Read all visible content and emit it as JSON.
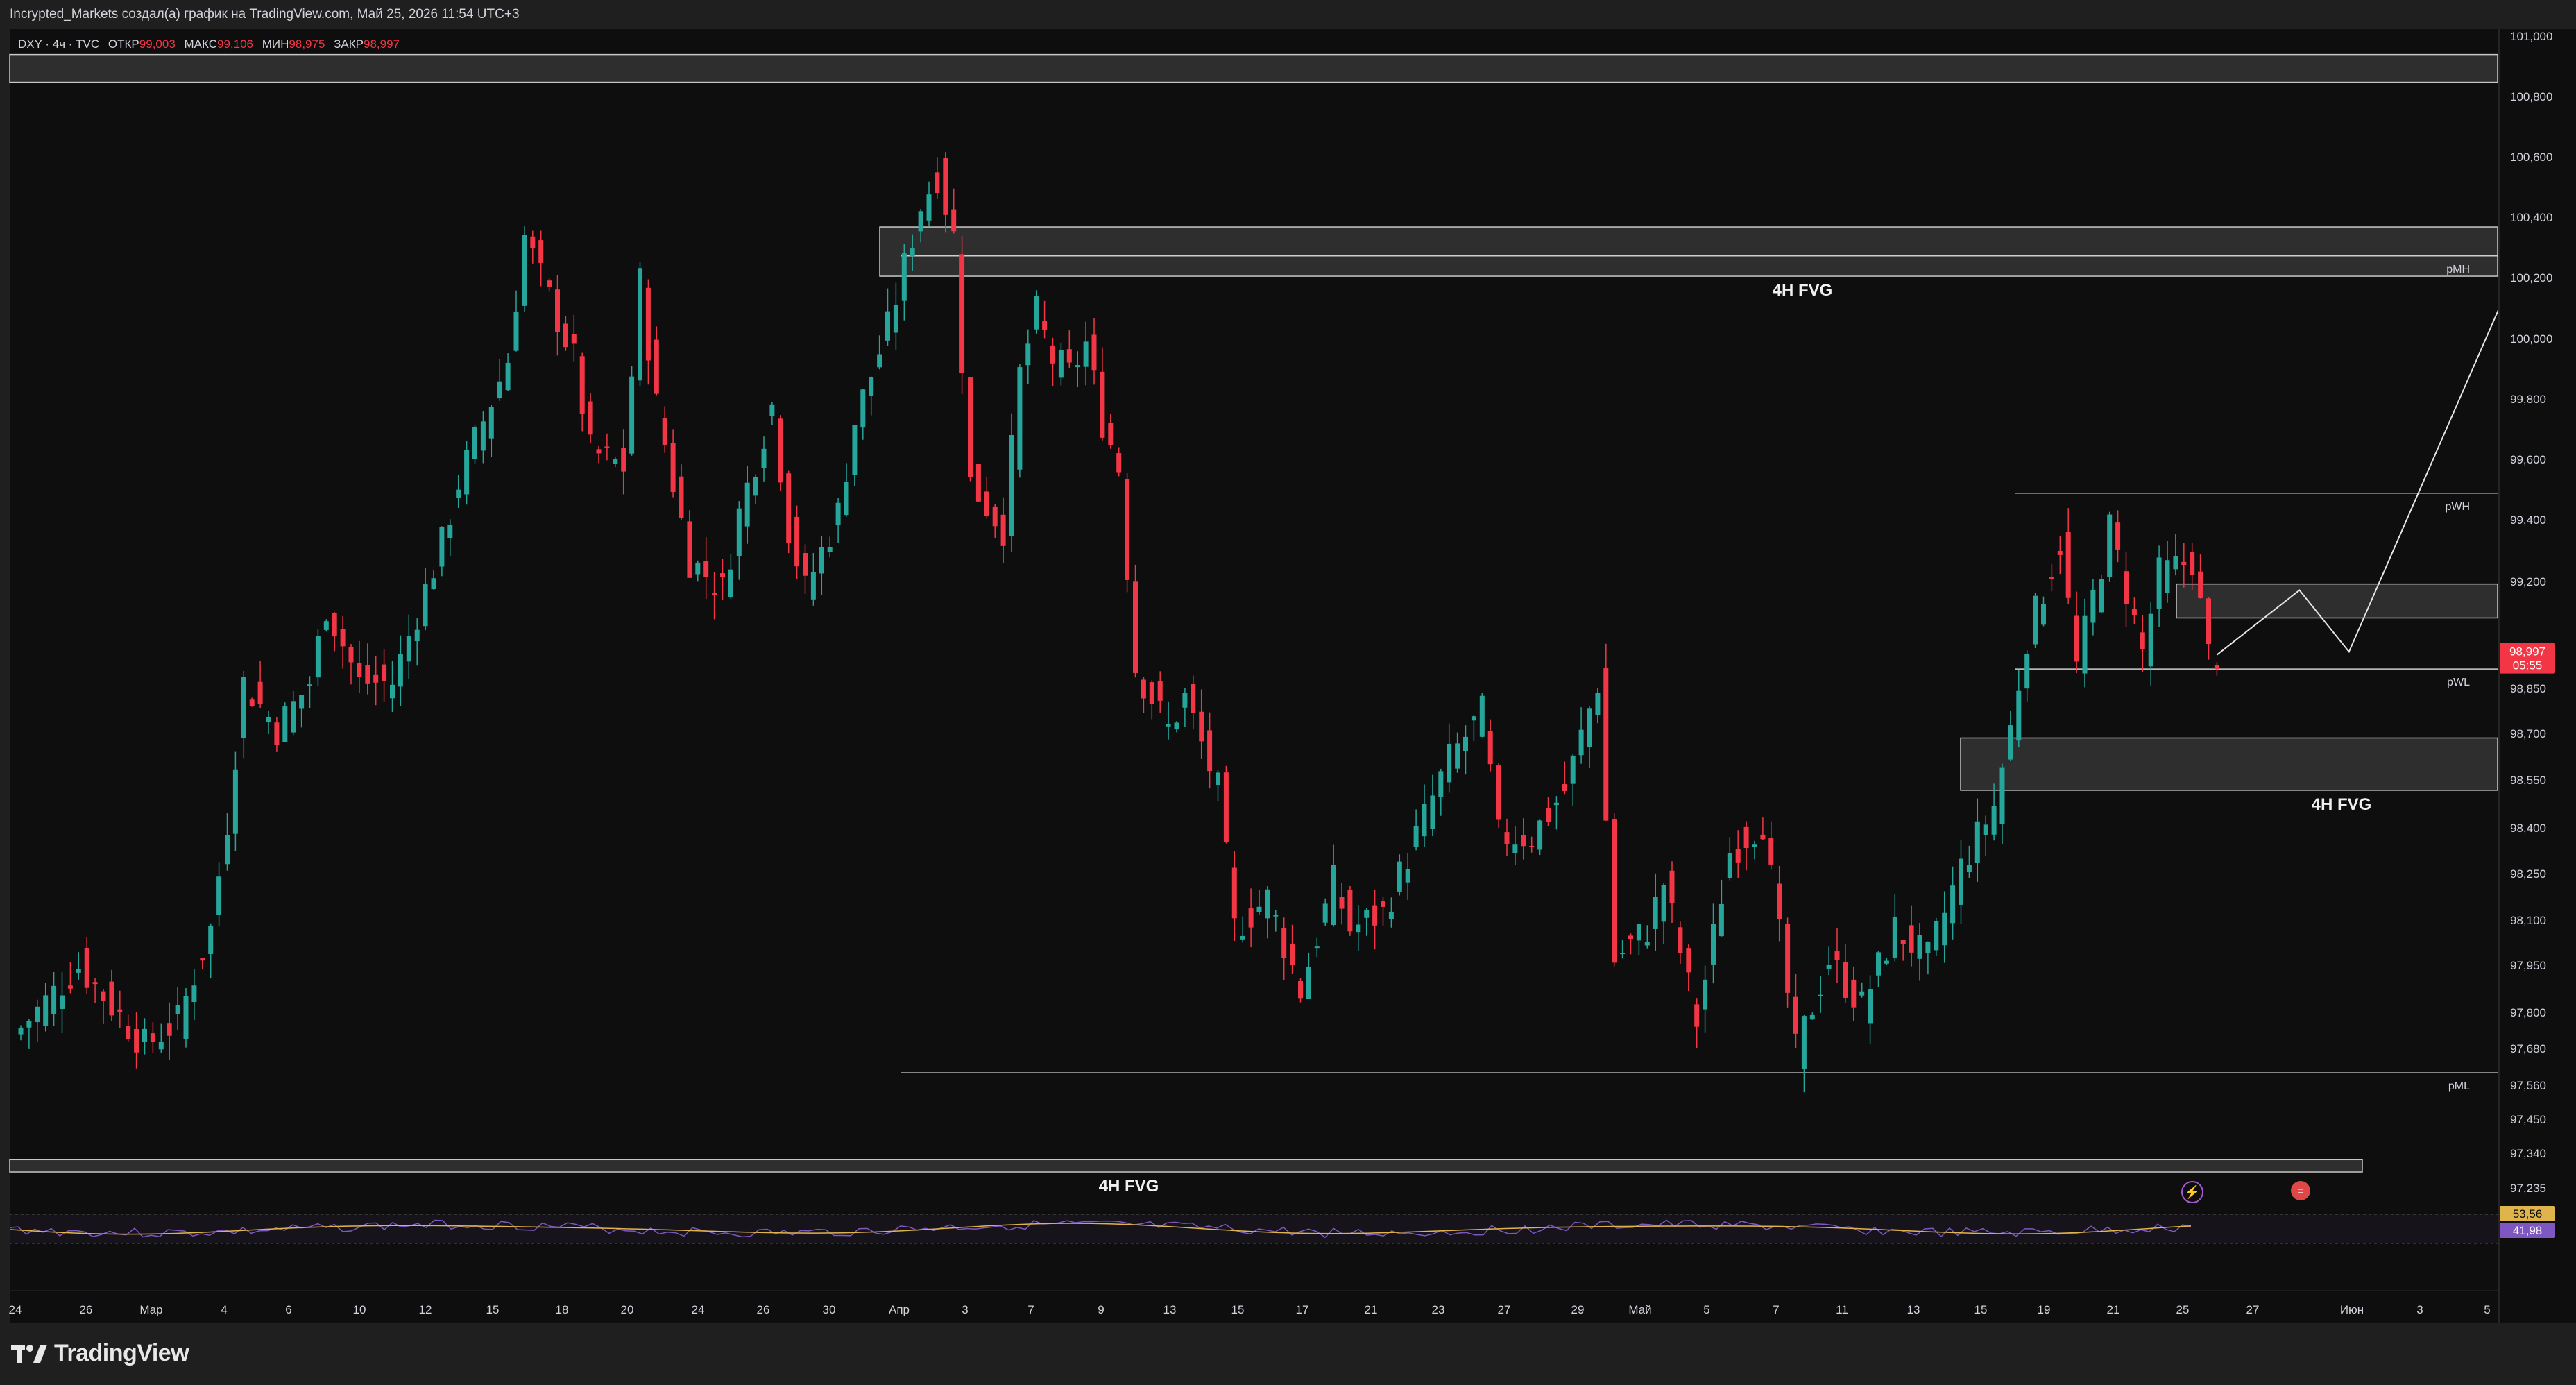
{
  "header": {
    "attribution": "Incrypted_Markets создал(а) график на TradingView.com, Май 25, 2026 11:54 UTC+3"
  },
  "legend": {
    "symbol": "DXY · 4ч · TVC",
    "open_label": "ОТКР",
    "open_value": "99,003",
    "high_label": "МАКС",
    "high_value": "99,106",
    "low_label": "МИН",
    "low_value": "98,975",
    "close_label": "ЗАКР",
    "close_value": "98,997"
  },
  "footer": {
    "brand": "TradingView"
  },
  "icons": {
    "lightning": "lightning-icon",
    "flag": "flag-event-icon"
  },
  "colors": {
    "up": "#26a69a",
    "down": "#f23645",
    "background": "#0e0e0e",
    "zone_fill": "#3a3a3a",
    "zone_border": "#c8c8c8",
    "rsi": "#7e57c2",
    "rsi_ma": "#e0b44c"
  },
  "chart_data": {
    "type": "candlestick",
    "symbol": "DXY",
    "timeframe": "4ч",
    "y_axis": {
      "range": [
        97.15,
        101.0
      ],
      "ticks": [
        "101,000",
        "100,800",
        "100,600",
        "100,400",
        "100,200",
        "100,000",
        "99,800",
        "99,600",
        "99,400",
        "99,200",
        "98,850",
        "98,700",
        "98,550",
        "98,400",
        "98,250",
        "98,100",
        "97,950",
        "97,800",
        "97,680",
        "97,560",
        "97,450",
        "97,340",
        "97,235"
      ]
    },
    "x_axis": {
      "ticks": [
        "24",
        "26",
        "Мар",
        "4",
        "6",
        "10",
        "12",
        "15",
        "18",
        "20",
        "24",
        "26",
        "30",
        "Апр",
        "3",
        "7",
        "9",
        "13",
        "15",
        "17",
        "21",
        "23",
        "27",
        "29",
        "Май",
        "5",
        "7",
        "11",
        "13",
        "15",
        "19",
        "21",
        "25",
        "27",
        "Июн",
        "3",
        "5"
      ]
    },
    "price_path": [
      [
        0,
        97.75
      ],
      [
        4,
        97.98
      ],
      [
        8,
        97.72
      ],
      [
        10,
        97.8
      ],
      [
        12,
        98.1
      ],
      [
        13,
        98.45
      ],
      [
        14,
        98.9
      ],
      [
        16,
        98.75
      ],
      [
        18,
        98.9
      ],
      [
        19,
        99.15
      ],
      [
        21,
        98.9
      ],
      [
        23,
        98.9
      ],
      [
        24,
        99.05
      ],
      [
        26,
        99.35
      ],
      [
        27,
        99.55
      ],
      [
        30,
        99.95
      ],
      [
        31,
        100.35
      ],
      [
        34,
        99.95
      ],
      [
        35,
        99.65
      ],
      [
        37,
        99.6
      ],
      [
        38,
        100.2
      ],
      [
        39,
        99.8
      ],
      [
        41,
        99.3
      ],
      [
        43,
        99.2
      ],
      [
        44,
        99.45
      ],
      [
        46,
        99.8
      ],
      [
        47,
        99.4
      ],
      [
        48,
        99.2
      ],
      [
        50,
        99.45
      ],
      [
        51,
        99.75
      ],
      [
        53,
        100.05
      ],
      [
        55,
        100.45
      ],
      [
        56,
        100.55
      ],
      [
        57,
        100.35
      ],
      [
        58,
        99.55
      ],
      [
        60,
        99.4
      ],
      [
        61,
        99.9
      ],
      [
        62,
        100.1
      ],
      [
        63,
        99.95
      ],
      [
        64,
        99.9
      ],
      [
        65,
        100.0
      ],
      [
        66,
        99.75
      ],
      [
        67,
        99.6
      ],
      [
        68,
        98.95
      ],
      [
        70,
        98.75
      ],
      [
        71,
        98.85
      ],
      [
        73,
        98.55
      ],
      [
        74,
        98.1
      ],
      [
        76,
        98.2
      ],
      [
        78,
        97.9
      ],
      [
        80,
        98.25
      ],
      [
        81,
        98.1
      ],
      [
        83,
        98.15
      ],
      [
        85,
        98.4
      ],
      [
        87,
        98.65
      ],
      [
        89,
        98.8
      ],
      [
        90,
        98.4
      ],
      [
        92,
        98.4
      ],
      [
        94,
        98.55
      ],
      [
        96,
        98.9
      ],
      [
        97,
        98.0
      ],
      [
        99,
        98.1
      ],
      [
        100,
        98.25
      ],
      [
        102,
        97.8
      ],
      [
        104,
        98.35
      ],
      [
        106,
        98.45
      ],
      [
        108,
        97.7
      ],
      [
        110,
        98.0
      ],
      [
        112,
        97.85
      ],
      [
        114,
        98.1
      ],
      [
        116,
        98.0
      ],
      [
        118,
        98.3
      ],
      [
        120,
        98.5
      ],
      [
        121,
        98.75
      ],
      [
        122,
        99.05
      ],
      [
        124,
        99.35
      ],
      [
        125,
        98.95
      ],
      [
        127,
        99.4
      ],
      [
        129,
        99.0
      ],
      [
        130,
        99.25
      ],
      [
        132,
        99.3
      ],
      [
        133,
        98.99
      ]
    ],
    "zones": [
      {
        "label": "4H FVG",
        "top": 100.38,
        "bottom": 100.22
      },
      {
        "label": "4H FVG",
        "top": 98.72,
        "bottom": 98.55
      },
      {
        "label": "4H FVG",
        "top": 97.35,
        "bottom": 97.31
      },
      {
        "label": "",
        "top": 100.94,
        "bottom": 100.85
      },
      {
        "label": "",
        "top": 99.22,
        "bottom": 99.11
      }
    ],
    "levels": [
      {
        "name": "pMH",
        "value": 100.286,
        "label": "100,286"
      },
      {
        "name": "pWH",
        "value": 99.515,
        "label": "99,515"
      },
      {
        "name": "pWL",
        "value": 98.944,
        "label": "98,944"
      },
      {
        "name": "pML",
        "value": 97.632,
        "label": "97,632"
      }
    ],
    "last_price": {
      "value": 98.997,
      "label": "98,997",
      "countdown": "05:55"
    },
    "projection": [
      [
        133,
        98.99
      ],
      [
        138,
        99.2
      ],
      [
        141,
        99.0
      ],
      [
        152,
        100.35
      ]
    ],
    "rsi": {
      "value": "53,56",
      "ma_value": "41,98"
    }
  }
}
